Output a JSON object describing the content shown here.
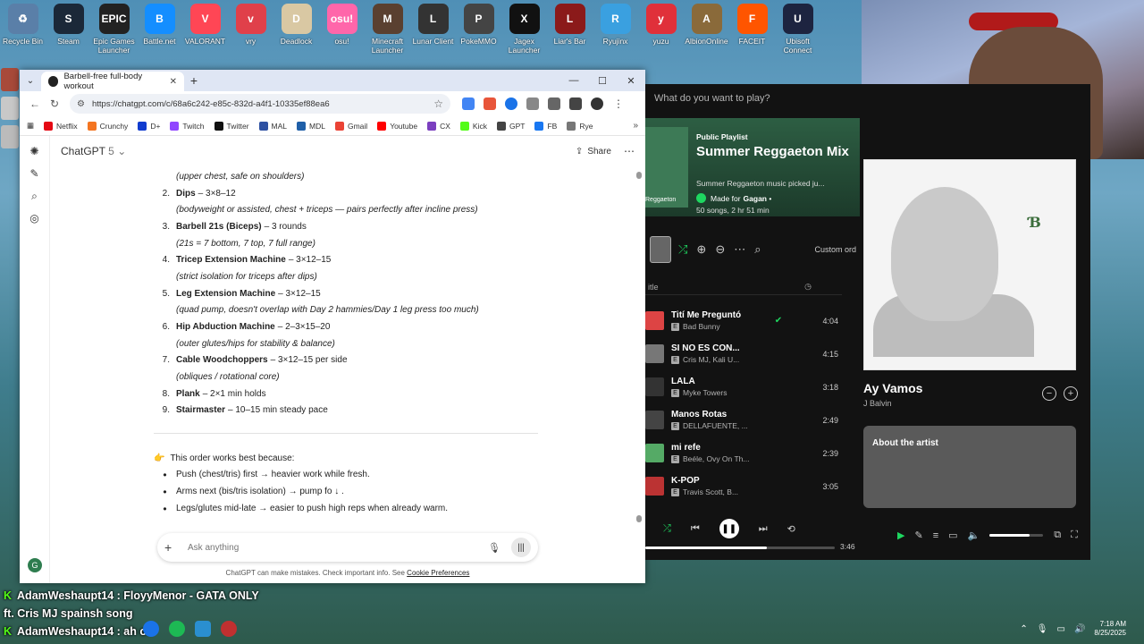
{
  "desktop": {
    "icons": [
      {
        "label": "Recycle Bin",
        "color": "#5a7fa8",
        "glyph": "♻"
      },
      {
        "label": "Steam",
        "color": "#1b2838",
        "glyph": "S"
      },
      {
        "label": "Epic Games Launcher",
        "color": "#222222",
        "glyph": "EPIC"
      },
      {
        "label": "Battle.net",
        "color": "#148eff",
        "glyph": "B"
      },
      {
        "label": "VALORANT",
        "color": "#ff4655",
        "glyph": "V"
      },
      {
        "label": "vry",
        "color": "#e0404a",
        "glyph": "v"
      },
      {
        "label": "Deadlock",
        "color": "#d9c8a3",
        "glyph": "D"
      },
      {
        "label": "osu!",
        "color": "#ff66aa",
        "glyph": "osu!"
      },
      {
        "label": "Minecraft Launcher",
        "color": "#5a4030",
        "glyph": "M"
      },
      {
        "label": "Lunar Client",
        "color": "#333333",
        "glyph": "L"
      },
      {
        "label": "PokeMMO",
        "color": "#444444",
        "glyph": "P"
      },
      {
        "label": "Jagex Launcher",
        "color": "#111111",
        "glyph": "X"
      },
      {
        "label": "Liar's Bar",
        "color": "#8b1a1a",
        "glyph": "L"
      },
      {
        "label": "Ryujinx",
        "color": "#3aa0e0",
        "glyph": "R"
      },
      {
        "label": "yuzu",
        "color": "#e0303a",
        "glyph": "y"
      },
      {
        "label": "AlbionOnline",
        "color": "#8a6a3a",
        "glyph": "A"
      },
      {
        "label": "FACEIT",
        "color": "#ff5500",
        "glyph": "F"
      },
      {
        "label": "Ubisoft Connect",
        "color": "#1d2440",
        "glyph": "U"
      }
    ]
  },
  "browser": {
    "tab_title": "Barbell-free full-body workout",
    "url": "https://chatgpt.com/c/68a6c242-e85c-832d-a4f1-10335ef88ea6",
    "bookmarks": [
      {
        "label": "Netflix",
        "color": "#e50914"
      },
      {
        "label": "Crunchy",
        "color": "#f47521"
      },
      {
        "label": "D+",
        "color": "#113ccf"
      },
      {
        "label": "Twitch",
        "color": "#9146ff"
      },
      {
        "label": "Twitter",
        "color": "#111111"
      },
      {
        "label": "MAL",
        "color": "#2e51a2"
      },
      {
        "label": "MDL",
        "color": "#1f5fa8"
      },
      {
        "label": "Gmail",
        "color": "#ea4335"
      },
      {
        "label": "Youtube",
        "color": "#ff0000"
      },
      {
        "label": "CX",
        "color": "#7b3fbf"
      },
      {
        "label": "Kick",
        "color": "#53fc18"
      },
      {
        "label": "GPT",
        "color": "#444444"
      },
      {
        "label": "FB",
        "color": "#1877f2"
      },
      {
        "label": "Rye",
        "color": "#777777"
      }
    ]
  },
  "chatgpt": {
    "title": "ChatGPT",
    "version": "5",
    "share_label": "Share",
    "items": [
      {
        "num": "",
        "name": "",
        "rest": "",
        "note": "(upper chest, safe on shoulders)"
      },
      {
        "num": "2.",
        "name": "Dips",
        "rest": "– 3×8–12",
        "note": "(bodyweight or assisted, chest + triceps — pairs perfectly after incline press)"
      },
      {
        "num": "3.",
        "name": "Barbell 21s (Biceps)",
        "rest": "– 3 rounds",
        "note": "(21s = 7 bottom, 7 top, 7 full range)"
      },
      {
        "num": "4.",
        "name": "Tricep Extension Machine",
        "rest": "– 3×12–15",
        "note": "(strict isolation for triceps after dips)"
      },
      {
        "num": "5.",
        "name": "Leg Extension Machine",
        "rest": "– 3×12–15",
        "note": "(quad pump, doesn't overlap with Day 2 hammies/Day 1 leg press too much)"
      },
      {
        "num": "6.",
        "name": "Hip Abduction Machine",
        "rest": "– 2–3×15–20",
        "note": "(outer glutes/hips for stability & balance)"
      },
      {
        "num": "7.",
        "name": "Cable Woodchoppers",
        "rest": "– 3×12–15 per side",
        "note": "(obliques / rotational core)"
      },
      {
        "num": "8.",
        "name": "Plank",
        "rest": "– 2×1 min holds",
        "note": ""
      },
      {
        "num": "9.",
        "name": "Stairmaster",
        "rest": "– 10–15 min steady pace",
        "note": ""
      }
    ],
    "why_text": "This order works best because:",
    "bullets": [
      "Push (chest/tris) first → heavier work while fresh.",
      "Arms next (bis/tris isolation) → pump fo ↓ .",
      "Legs/glutes mid-late → easier to push high reps when already warm."
    ],
    "input_placeholder": "Ask anything",
    "disclaimer": "ChatGPT can make mistakes. Check important info. See",
    "disclaimer_link": "Cookie Preferences",
    "avatar_letter": "G"
  },
  "spotify": {
    "search_placeholder": "What do you want to play?",
    "playlist_type": "Public Playlist",
    "playlist_title": "Summer Reggaeton Mix",
    "playlist_desc": "Summer Reggaeton music picked ju...",
    "cover_label": "Reggaeton",
    "made_for": "Made for",
    "owner": "Gagan",
    "stats": "50 songs, 2 hr 51 min",
    "custom_order": "Custom ord",
    "col_title": "itle",
    "tracks": [
      {
        "title": "Tití Me Preguntó",
        "artist": "Bad Bunny",
        "duration": "4:04",
        "saved": true,
        "color": "#d44"
      },
      {
        "title": "SI NO ES CON...",
        "artist": "Cris MJ, Kali U...",
        "duration": "4:15",
        "saved": false,
        "color": "#777"
      },
      {
        "title": "LALA",
        "artist": "Myke Towers",
        "duration": "3:18",
        "saved": false,
        "color": "#333"
      },
      {
        "title": "Manos Rotas",
        "artist": "DELLAFUENTE, ...",
        "duration": "2:49",
        "saved": false,
        "color": "#444"
      },
      {
        "title": "mi refe",
        "artist": "Beéle, Ovy On Th...",
        "duration": "2:39",
        "saved": false,
        "color": "#5a6"
      },
      {
        "title": "K-POP",
        "artist": "Travis Scott, B...",
        "duration": "3:05",
        "saved": false,
        "color": "#b33"
      }
    ],
    "now_playing_title": "Ay Vamos",
    "now_playing_artist": "J Balvin",
    "about_label": "About the artist",
    "progress_fraction": 0.64,
    "time_total": "3:46",
    "volume_fraction": 0.75
  },
  "chat_overlay": {
    "line1": "AdamWeshaupt14 : FloyyMenor - GATA ONLY",
    "line2": "ft. Cris MJ spainsh song",
    "line3": "AdamWeshaupt14 : ah ok"
  },
  "taskbar": {
    "time": "7:18 AM",
    "date": "8/25/2025"
  }
}
